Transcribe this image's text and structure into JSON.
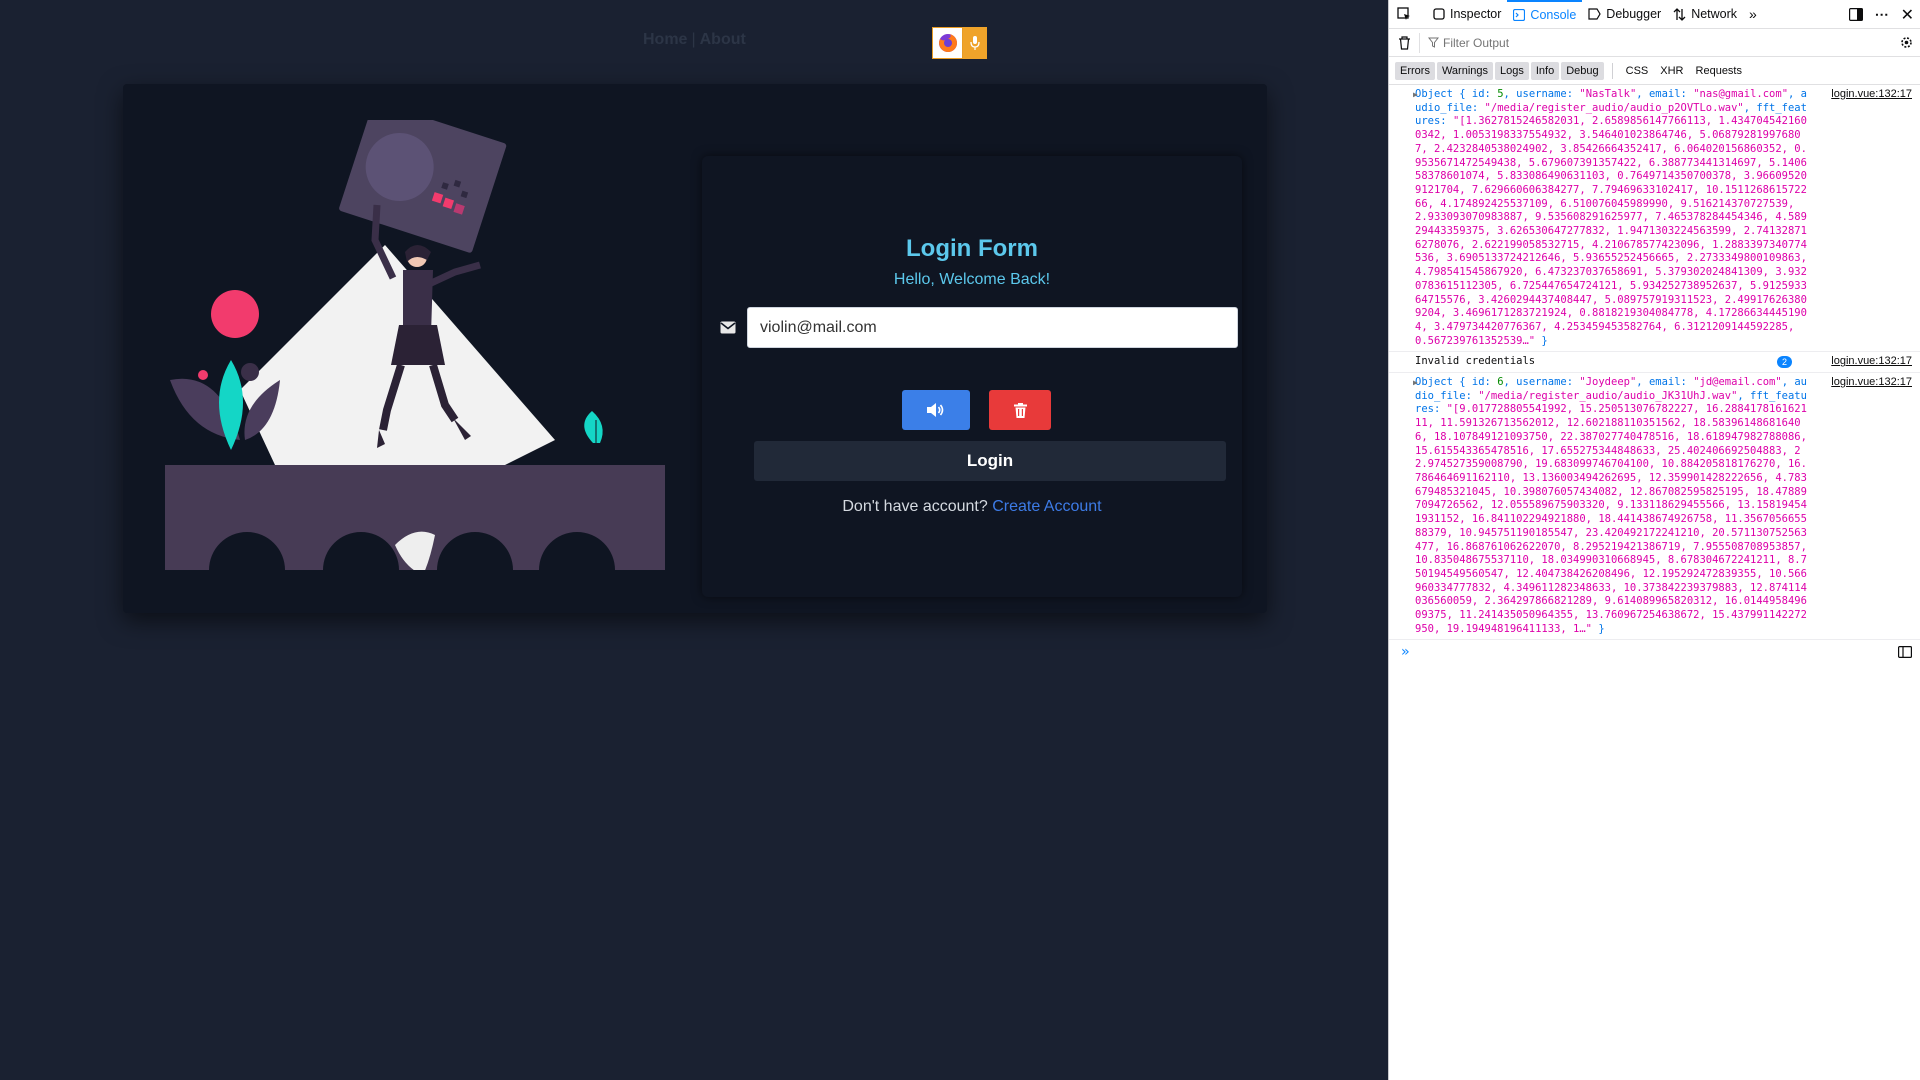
{
  "nav": {
    "home": "Home",
    "separator": "|",
    "about": "About"
  },
  "badges": {
    "firefox_icon": "firefox-icon",
    "mic_icon": "microphone-icon"
  },
  "login": {
    "title": "Login Form",
    "subtitle": "Hello, Welcome Back!",
    "email_value": "violin@mail.com",
    "login_button": "Login",
    "no_account_text": "Don't have account?",
    "create_account_link": "Create Account"
  },
  "devtools": {
    "tabs": [
      "Inspector",
      "Console",
      "Debugger",
      "Network"
    ],
    "filter_placeholder": "Filter Output",
    "categories_on": [
      "Errors",
      "Warnings",
      "Logs",
      "Info",
      "Debug"
    ],
    "categories_off": [
      "CSS",
      "XHR",
      "Requests"
    ],
    "entries": [
      {
        "prefix": "Object { ",
        "id_key": "id: ",
        "id_val": "5",
        "username_key": ", username: ",
        "username_val": "\"NasTalk\"",
        "email_key": ", email: ",
        "email_val": "\"nas@gmail.com\"",
        "audio_key": ", audio_file: ",
        "audio_val": "\"/media/register_audio/audio_p2OVTLo.wav\"",
        "fft_key": ", fft_features: ",
        "fft_val": "\"[1.3627815246582031, 2.6589856147766113, 1.4347045421600342, 1.0053198337554932, 3.546401023864746, 5.068792819976807, 2.4232840538024902, 3.85426664352417, 6.064020156860352, 0.9535671472549438, 5.679607391357422, 6.388773441314697, 5.140658378601074, 5.833086490631103, 0.7649714350700378, 3.966095209121704, 7.629660606384277, 7.79469633102417, 10.151126861572266, 4.174892425537109, 6.510076045989990, 9.516214370727539, 2.933093070983887, 9.535608291625977, 7.465378284454346, 4.58929443359375, 3.626530647277832, 1.9471303224563599, 2.741328716278076, 2.622199058532715, 4.210678577423096, 1.2883397340774536, 3.6905133724212646, 5.93655252456665, 2.2733349800109863, 4.798541545867920, 6.473237037658691, 5.379302024841309, 3.9320783615112305, 6.725447654724121, 5.934252738952637, 5.912593364715576, 3.4260294437408447, 5.089757919311523, 2.499176263809204, 3.4696171283721924, 0.8818219304084778, 4.172866344451904, 3.479734420776367, 4.253459453582764, 6.3121209144592285, 0.567239761352539…\"",
        "suffix": " }",
        "location": "login.vue:132:17"
      },
      {
        "message": "Invalid credentials",
        "count": "2",
        "location": "login.vue:132:17"
      },
      {
        "prefix": "Object { ",
        "id_key": "id: ",
        "id_val": "6",
        "username_key": ", username: ",
        "username_val": "\"Joydeep\"",
        "email_key": ", email: ",
        "email_val": "\"jd@email.com\"",
        "audio_key": ", audio_file: ",
        "audio_val": "\"/media/register_audio/audio_JK31UhJ.wav\"",
        "fft_key": ", fft_features: ",
        "fft_val": "\"[9.017728805541992, 15.250513076782227, 16.288417816162111, 11.591326713562012, 12.602188110351562, 18.583961486816406, 18.107849121093750, 22.387027740478516, 18.618947982788086, 15.615543365478516, 17.655275344848633, 25.402406692504883, 22.974527359008790, 19.683099746704100, 10.884205818176270, 16.786464691162110, 13.136003494262695, 12.359901428222656, 4.783679485321045, 10.398076057434082, 12.867082595825195, 18.478897094726562, 12.055589675903320, 9.133118629455566, 13.158194541931152, 16.841102294921880, 18.441438674926758, 11.356705665588379, 10.945751190185547, 23.420492172241210, 20.571130752563477, 16.868761062622070, 8.295219421386719, 7.955508708953857, 10.835048675537110, 18.034990310668945, 8.678304672241211, 8.750194549560547, 12.404738426208496, 12.195292472839355, 10.566960334777832, 4.349611282348633, 10.373842239379883, 12.874114036560059, 2.364297866821289, 9.614089965820312, 16.014495849609375, 11.241435050964355, 13.760967254638672, 15.437991142272950, 19.194948196411133, 1…\"",
        "suffix": " }",
        "location": "login.vue:132:17"
      }
    ]
  }
}
